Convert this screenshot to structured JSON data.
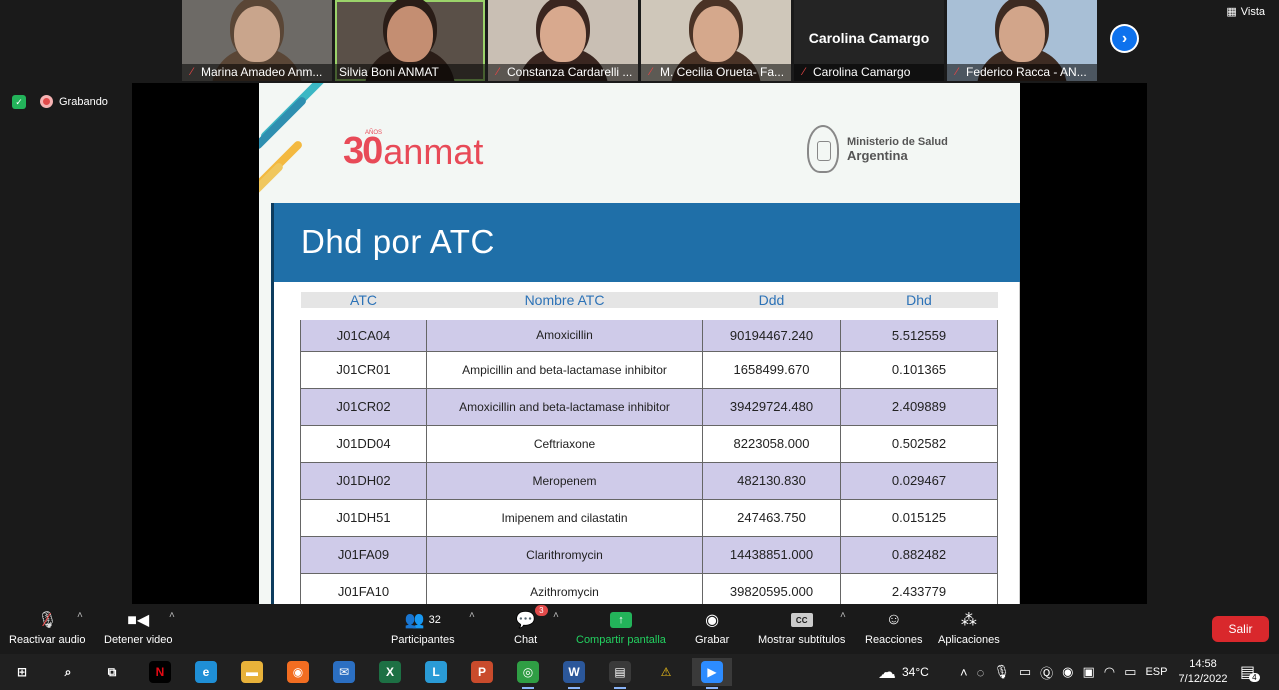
{
  "participants": [
    {
      "name": "Marina Amadeo Anm...",
      "muted": true,
      "skin": "#c9a58c",
      "hair": "#5a4636",
      "bg": "#6d6a66"
    },
    {
      "name": "Silvia Boni ANMAT",
      "muted": false,
      "active": true,
      "skin": "#c48e72",
      "hair": "#2a1d17",
      "bg": "#5a5048"
    },
    {
      "name": "Constanza Cardarelli ...",
      "muted": true,
      "skin": "#d8a98e",
      "hair": "#3a2620",
      "bg": "#c9bfb4"
    },
    {
      "name": "M. Cecilia Orueta- Fa...",
      "muted": true,
      "skin": "#d5a88c",
      "hair": "#4a3326",
      "bg": "#cfc7ba"
    },
    {
      "name": "Carolina Camargo",
      "muted": true,
      "avatar_name": "Carolina Camargo"
    },
    {
      "name": "Federico Racca - AN...",
      "muted": true,
      "skin": "#d2a58a",
      "hair": "#3d2b22",
      "bg": "#a8bfd6"
    }
  ],
  "view_label": "Vista",
  "recording_label": "Grabando",
  "slide": {
    "logo_number": "30",
    "logo_anos": "AÑOS",
    "logo_word": "anmat",
    "ministry_line1": "Ministerio de Salud",
    "ministry_line2": "Argentina",
    "title": "Dhd por ATC",
    "headers": [
      "ATC",
      "Nombre ATC",
      "Ddd",
      "Dhd"
    ],
    "rows": [
      [
        "J01CA04",
        "Amoxicillin",
        "90194467.240",
        "5.512559"
      ],
      [
        "J01CR01",
        "Ampicillin and beta-lactamase inhibitor",
        "1658499.670",
        "0.101365"
      ],
      [
        "J01CR02",
        "Amoxicillin and beta-lactamase inhibitor",
        "39429724.480",
        "2.409889"
      ],
      [
        "J01DD04",
        "Ceftriaxone",
        "8223058.000",
        "0.502582"
      ],
      [
        "J01DH02",
        "Meropenem",
        "482130.830",
        "0.029467"
      ],
      [
        "J01DH51",
        "Imipenem and cilastatin",
        "247463.750",
        "0.015125"
      ],
      [
        "J01FA09",
        "Clarithromycin",
        "14438851.000",
        "0.882482"
      ],
      [
        "J01FA10",
        "Azithromycin",
        "39820595.000",
        "2.433779"
      ]
    ]
  },
  "controls": {
    "audio": "Reactivar audio",
    "video": "Detener video",
    "participants": "Participantes",
    "participants_count": "32",
    "chat": "Chat",
    "chat_badge": "3",
    "share": "Compartir pantalla",
    "record": "Grabar",
    "subtitles": "Mostrar subtítulos",
    "reactions": "Reacciones",
    "apps": "Aplicaciones",
    "leave": "Salir",
    "cc": "CC"
  },
  "taskbar": {
    "apps": [
      {
        "id": "start",
        "glyph": "⊞",
        "color": "#202020"
      },
      {
        "id": "search",
        "glyph": "⌕",
        "color": "#202020"
      },
      {
        "id": "task-view",
        "glyph": "⧉",
        "color": "#202020"
      },
      {
        "id": "netflix",
        "glyph": "N",
        "color": "#000000"
      },
      {
        "id": "edge",
        "glyph": "e",
        "color": "#1f8fd6"
      },
      {
        "id": "explorer",
        "glyph": "▬",
        "color": "#e8b23a"
      },
      {
        "id": "firefox",
        "glyph": "◉",
        "color": "#f26d21"
      },
      {
        "id": "mail",
        "glyph": "✉",
        "color": "#2b6fc2"
      },
      {
        "id": "excel",
        "glyph": "X",
        "color": "#1d7044"
      },
      {
        "id": "l-app",
        "glyph": "L",
        "color": "#2a9bd6"
      },
      {
        "id": "powerpoint",
        "glyph": "P",
        "color": "#c94b2c"
      },
      {
        "id": "chrome",
        "glyph": "◎",
        "color": "#2f9e44"
      },
      {
        "id": "word",
        "glyph": "W",
        "color": "#2b579a"
      },
      {
        "id": "whiteboard",
        "glyph": "▤",
        "color": "#3a3a3a"
      },
      {
        "id": "warning",
        "glyph": "⚠",
        "color": "#202020"
      },
      {
        "id": "zoom",
        "glyph": "▶",
        "color": "#2d8cff"
      }
    ],
    "weather": "34°C",
    "lang": "ESP",
    "time": "14:58",
    "date": "7/12/2022",
    "notif_count": "4"
  }
}
